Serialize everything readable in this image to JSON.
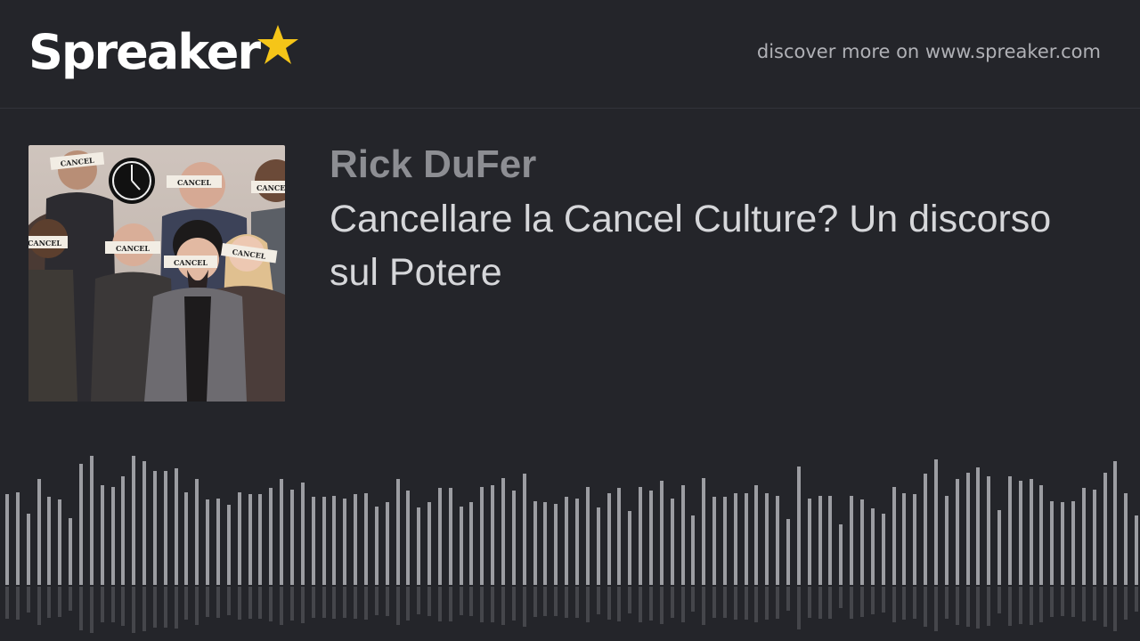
{
  "header": {
    "logo_text": "Spreaker",
    "logo_icon": "star-icon",
    "logo_star_color": "#f5c518",
    "discover_text": "discover more on www.spreaker.com"
  },
  "episode": {
    "author": "Rick DuFer",
    "title": "Cancellare la Cancel Culture? Un discorso sul Potere",
    "cover_image": {
      "labels": [
        "CANCEL",
        "CANCEL",
        "CANCEL",
        "CANCEL",
        "CANCEL",
        "CANCEL",
        "CANCEL"
      ],
      "icon": "clock-icon"
    }
  },
  "waveform": {
    "bar_color": "#9c9da2",
    "levels": [
      0.7,
      0.72,
      0.55,
      0.82,
      0.68,
      0.66,
      0.52,
      0.94,
      1.0,
      0.77,
      0.76,
      0.84,
      1.0,
      0.96,
      0.88,
      0.88,
      0.9,
      0.72,
      0.82,
      0.66,
      0.67,
      0.62,
      0.72,
      0.7,
      0.7,
      0.75,
      0.82,
      0.74,
      0.79,
      0.68,
      0.68,
      0.69,
      0.67,
      0.7,
      0.71,
      0.61,
      0.64,
      0.82,
      0.73,
      0.6,
      0.64,
      0.75,
      0.75,
      0.61,
      0.64,
      0.76,
      0.77,
      0.83,
      0.73,
      0.86,
      0.65,
      0.64,
      0.63,
      0.68,
      0.67,
      0.76,
      0.6,
      0.71,
      0.75,
      0.57,
      0.76,
      0.73,
      0.81,
      0.67,
      0.77,
      0.54,
      0.83,
      0.68,
      0.68,
      0.71,
      0.71,
      0.77,
      0.71,
      0.69,
      0.51,
      0.92,
      0.67,
      0.69,
      0.69,
      0.47,
      0.69,
      0.66,
      0.59,
      0.55,
      0.76,
      0.71,
      0.7,
      0.86,
      0.97,
      0.69,
      0.82,
      0.87,
      0.91,
      0.84,
      0.58,
      0.84,
      0.81,
      0.82,
      0.77,
      0.65,
      0.64,
      0.65,
      0.75,
      0.74,
      0.87,
      0.96,
      0.71,
      0.54
    ]
  }
}
